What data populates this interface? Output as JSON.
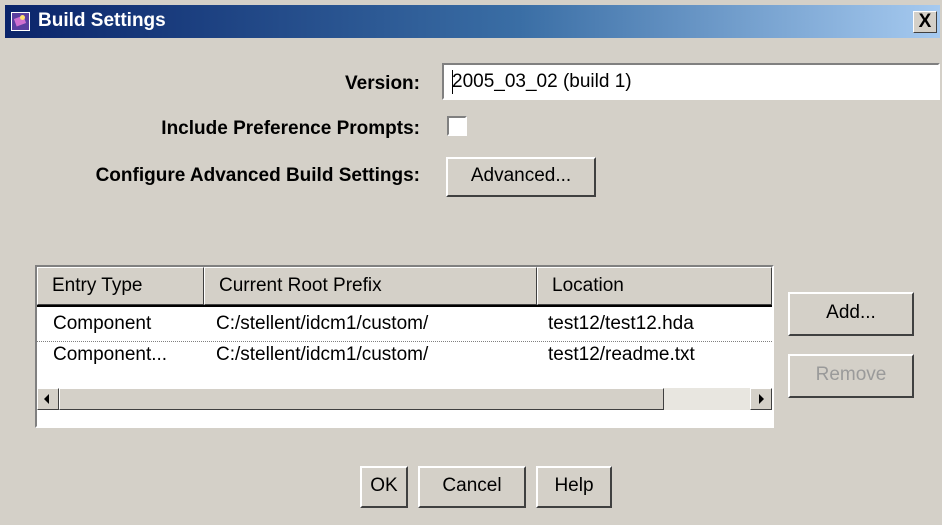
{
  "window": {
    "title": "Build Settings",
    "close_glyph": "X",
    "icon": "app-icon"
  },
  "form": {
    "version_label": "Version:",
    "version_value": "2005_03_02 (build 1)",
    "prompts_label": "Include Preference Prompts:",
    "prompts_checked": false,
    "advanced_label": "Configure Advanced Build Settings:",
    "advanced_button": "Advanced..."
  },
  "table": {
    "columns": [
      "Entry Type",
      "Current Root Prefix",
      "Location"
    ],
    "rows": [
      [
        "Component",
        "C:/stellent/idcm1/custom/",
        "test12/test12.hda"
      ],
      [
        "Component...",
        "C:/stellent/idcm1/custom/",
        "test12/readme.txt"
      ]
    ]
  },
  "side_buttons": {
    "add": "Add...",
    "remove": "Remove"
  },
  "footer": {
    "ok": "OK",
    "cancel": "Cancel",
    "help": "Help"
  }
}
